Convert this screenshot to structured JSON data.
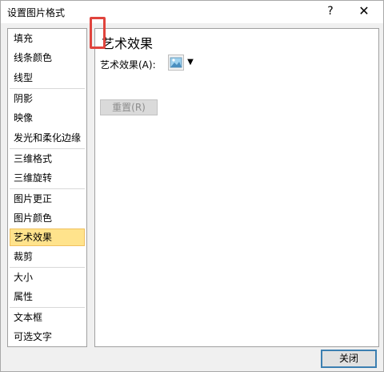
{
  "dialog": {
    "title": "设置图片格式",
    "help_label": "?",
    "close_symbol": "✕"
  },
  "sidebar": {
    "items": [
      {
        "label": "填充"
      },
      {
        "label": "线条颜色"
      },
      {
        "label": "线型"
      },
      {
        "label": "阴影"
      },
      {
        "label": "映像"
      },
      {
        "label": "发光和柔化边缘"
      },
      {
        "label": "三维格式"
      },
      {
        "label": "三维旋转"
      },
      {
        "label": "图片更正"
      },
      {
        "label": "图片颜色"
      },
      {
        "label": "艺术效果"
      },
      {
        "label": "裁剪"
      },
      {
        "label": "大小"
      },
      {
        "label": "属性"
      },
      {
        "label": "文本框"
      },
      {
        "label": "可选文字"
      }
    ],
    "selected_index": 10
  },
  "main": {
    "section_title": "艺术效果",
    "effect_label": "艺术效果(A):",
    "dropdown_icon": "triangle-down",
    "reset_label": "重置(R)"
  },
  "footer": {
    "close_label": "关闭"
  },
  "colors": {
    "selected_bg": "#ffe38c",
    "highlight_border": "#e0443d",
    "primary_button_border": "#3c7fb1"
  }
}
